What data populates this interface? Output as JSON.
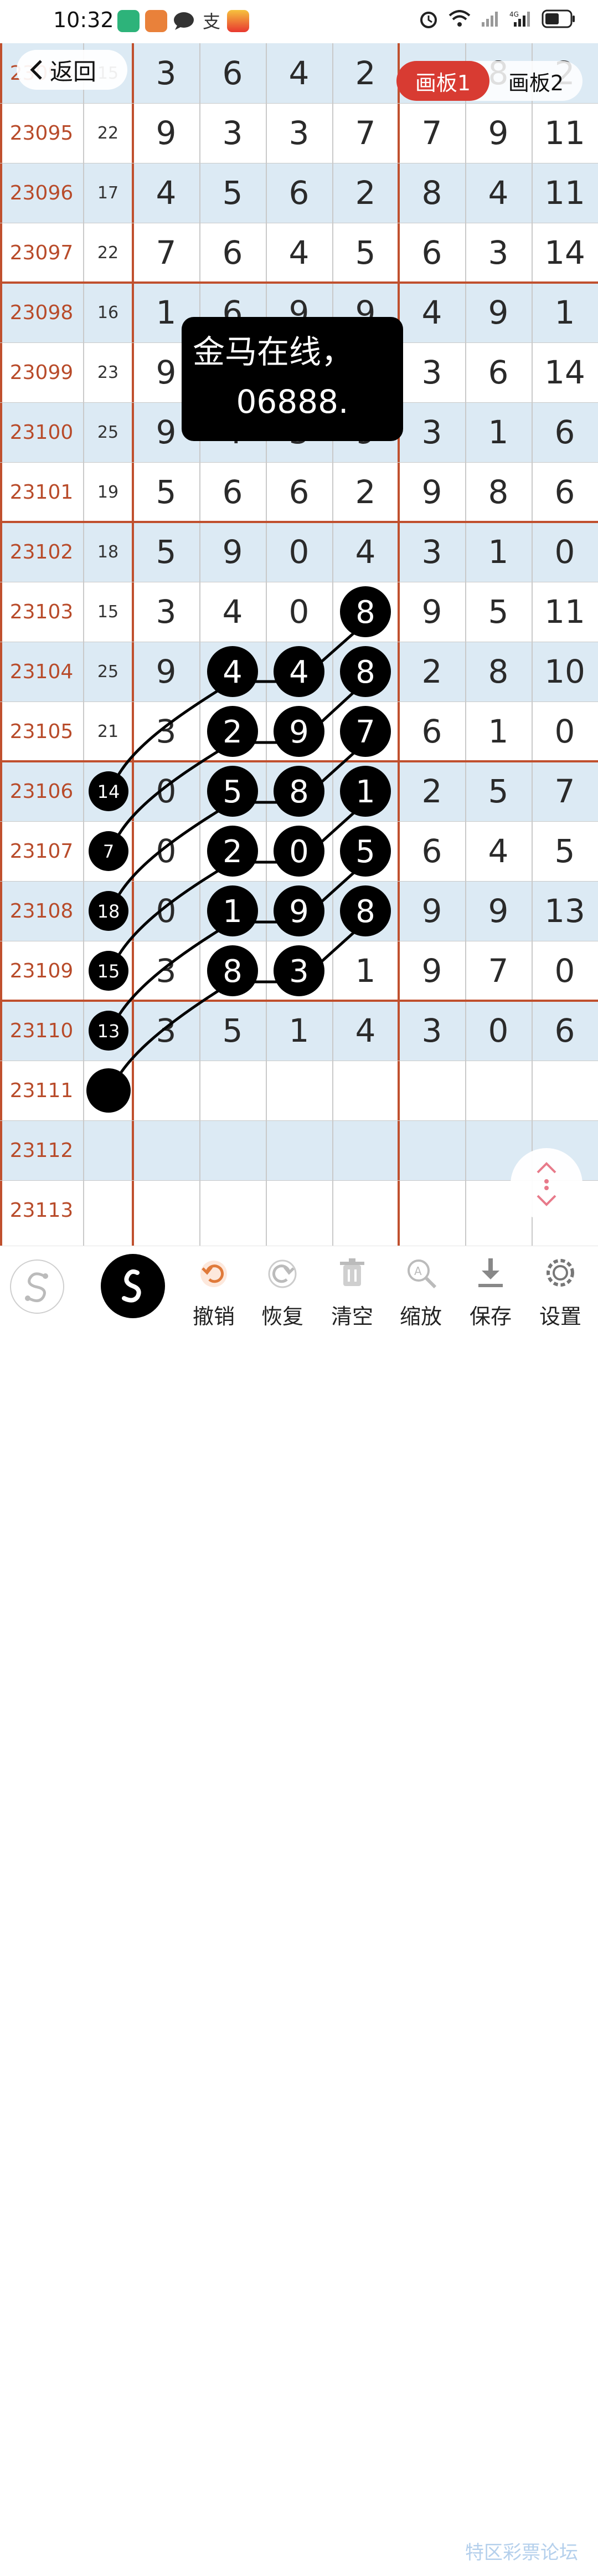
{
  "status_bar": {
    "time": "10:32"
  },
  "nav": {
    "back_label": "返回",
    "tab_active": "画板1",
    "tab_inactive": "画板2"
  },
  "toast": {
    "line1": "金马在线，",
    "line2": "06888."
  },
  "table": {
    "rows": [
      {
        "issue": "23094",
        "sum": "15",
        "nums": [
          "3",
          "6",
          "4",
          "2",
          "",
          "8",
          "2"
        ]
      },
      {
        "issue": "23095",
        "sum": "22",
        "nums": [
          "9",
          "3",
          "3",
          "7",
          "7",
          "9",
          "11"
        ]
      },
      {
        "issue": "23096",
        "sum": "17",
        "nums": [
          "4",
          "5",
          "6",
          "2",
          "8",
          "4",
          "11"
        ]
      },
      {
        "issue": "23097",
        "sum": "22",
        "nums": [
          "7",
          "6",
          "4",
          "5",
          "6",
          "3",
          "14"
        ]
      },
      {
        "issue": "23098",
        "sum": "16",
        "nums": [
          "1",
          "6",
          "9",
          "9",
          "4",
          "9",
          "1"
        ]
      },
      {
        "issue": "23099",
        "sum": "23",
        "nums": [
          "9",
          "",
          "",
          "",
          "3",
          "6",
          "14"
        ]
      },
      {
        "issue": "23100",
        "sum": "25",
        "nums": [
          "9",
          "4",
          "3",
          "9",
          "3",
          "1",
          "6"
        ]
      },
      {
        "issue": "23101",
        "sum": "19",
        "nums": [
          "5",
          "6",
          "6",
          "2",
          "9",
          "8",
          "6"
        ]
      },
      {
        "issue": "23102",
        "sum": "18",
        "nums": [
          "5",
          "9",
          "0",
          "4",
          "3",
          "1",
          "0"
        ]
      },
      {
        "issue": "23103",
        "sum": "15",
        "nums": [
          "3",
          "4",
          "0",
          "8",
          "9",
          "5",
          "11"
        ]
      },
      {
        "issue": "23104",
        "sum": "25",
        "nums": [
          "9",
          "4",
          "4",
          "8",
          "2",
          "8",
          "10"
        ]
      },
      {
        "issue": "23105",
        "sum": "21",
        "nums": [
          "3",
          "2",
          "9",
          "7",
          "6",
          "1",
          "0"
        ]
      },
      {
        "issue": "23106",
        "sum": "14",
        "nums": [
          "0",
          "5",
          "8",
          "1",
          "2",
          "5",
          "7"
        ]
      },
      {
        "issue": "23107",
        "sum": "7",
        "nums": [
          "0",
          "2",
          "0",
          "5",
          "6",
          "4",
          "5"
        ]
      },
      {
        "issue": "23108",
        "sum": "18",
        "nums": [
          "0",
          "1",
          "9",
          "8",
          "9",
          "9",
          "13"
        ]
      },
      {
        "issue": "23109",
        "sum": "15",
        "nums": [
          "3",
          "8",
          "3",
          "1",
          "9",
          "7",
          "0"
        ]
      },
      {
        "issue": "23110",
        "sum": "13",
        "nums": [
          "3",
          "5",
          "1",
          "4",
          "3",
          "0",
          "6"
        ]
      },
      {
        "issue": "23111",
        "sum": "",
        "nums": [
          "",
          "",
          "",
          "",
          "",
          "",
          ""
        ]
      },
      {
        "issue": "23112",
        "sum": "",
        "nums": [
          "",
          "",
          "",
          "",
          "",
          "",
          ""
        ]
      },
      {
        "issue": "23113",
        "sum": "",
        "nums": [
          "",
          "",
          "",
          "",
          "",
          "",
          ""
        ]
      }
    ]
  },
  "toolbar": {
    "items": [
      {
        "label": "撤销",
        "icon": "undo-icon"
      },
      {
        "label": "恢复",
        "icon": "redo-icon"
      },
      {
        "label": "清空",
        "icon": "trash-icon"
      },
      {
        "label": "缩放",
        "icon": "zoom-icon"
      },
      {
        "label": "保存",
        "icon": "download-icon"
      },
      {
        "label": "设置",
        "icon": "gear-icon"
      }
    ]
  },
  "watermark": "特区彩票论坛",
  "colors": {
    "accent_red": "#d83b32",
    "issue_text": "#b84b2a",
    "row_shade": "#dceaf4",
    "grid_thick": "#c0502e",
    "undo_orange": "#e07a3a"
  }
}
